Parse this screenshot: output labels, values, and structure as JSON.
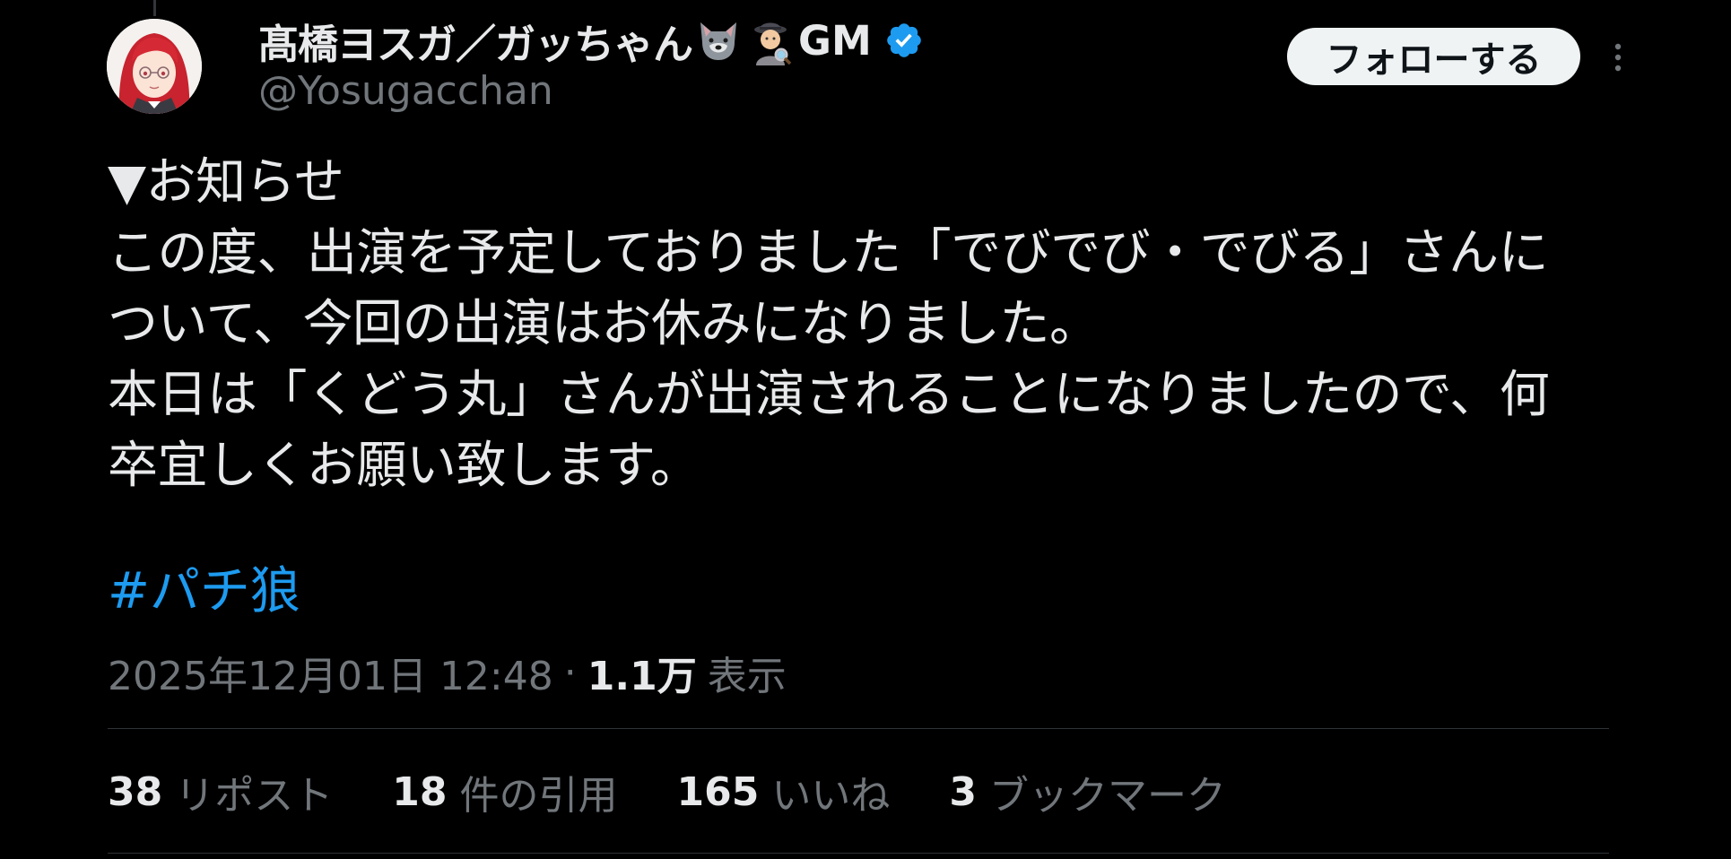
{
  "author": {
    "display_name": "髙橋ヨスガ／ガッちゃん",
    "name_suffix": "GM",
    "handle": "@Yosugacchan",
    "emoji_icons": [
      "wolf-face-icon",
      "detective-icon"
    ],
    "verified": true
  },
  "header": {
    "follow_label": "フォローする"
  },
  "tweet": {
    "lines": [
      "▼お知らせ",
      "この度、出演を予定しておりました「でびでび・でびる」さんに",
      "ついて、今回の出演はお休みになりました。",
      "本日は「くどう丸」さんが出演されることになりましたので、何",
      "卒宜しくお願い致します。"
    ],
    "hashtag": "#パチ狼"
  },
  "meta": {
    "timestamp": "2025年12月01日 12:48",
    "separator": "·",
    "views_count": "1.1万",
    "views_label": "表示"
  },
  "stats": {
    "reposts": {
      "count": "38",
      "label": "リポスト"
    },
    "quotes": {
      "count": "18",
      "label": "件の引用"
    },
    "likes": {
      "count": "165",
      "label": "いいね"
    },
    "bookmarks": {
      "count": "3",
      "label": "ブックマーク"
    }
  },
  "colors": {
    "background": "#000000",
    "text": "#e7e9ea",
    "muted": "#71767b",
    "link": "#1d9bf0",
    "verified": "#1d9bf0",
    "follow_bg": "#eff3f4",
    "divider": "#2f3336"
  }
}
